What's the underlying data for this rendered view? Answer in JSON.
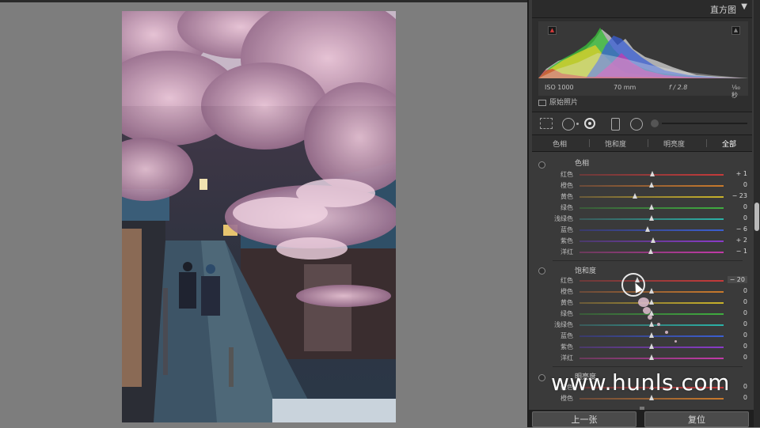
{
  "histogram": {
    "title": "直方图",
    "toggle_icon": "triangle-down",
    "exif": {
      "iso": "ISO 1000",
      "focal": "70 mm",
      "aperture": "f / 2.8",
      "shutter": "¹⁄₈₀ 秒"
    },
    "original_label": "原始照片"
  },
  "hsl": {
    "tabs": [
      "色相",
      "饱和度",
      "明亮度",
      "全部"
    ],
    "active_tab": "全部",
    "hue": {
      "title": "色相",
      "rows": [
        {
          "label": "红色",
          "value": "+ 1",
          "level": 1
        },
        {
          "label": "橙色",
          "value": "0",
          "level": 0
        },
        {
          "label": "黄色",
          "value": "− 23",
          "level": -23
        },
        {
          "label": "绿色",
          "value": "0",
          "level": 0
        },
        {
          "label": "浅绿色",
          "value": "0",
          "level": 0
        },
        {
          "label": "蓝色",
          "value": "− 6",
          "level": -6
        },
        {
          "label": "紫色",
          "value": "+ 2",
          "level": 2
        },
        {
          "label": "洋红",
          "value": "− 1",
          "level": -1
        }
      ]
    },
    "saturation": {
      "title": "饱和度",
      "rows": [
        {
          "label": "红色",
          "value": "− 20",
          "level": -20
        },
        {
          "label": "橙色",
          "value": "0",
          "level": 0
        },
        {
          "label": "黄色",
          "value": "0",
          "level": 0
        },
        {
          "label": "绿色",
          "value": "0",
          "level": 0
        },
        {
          "label": "浅绿色",
          "value": "0",
          "level": 0
        },
        {
          "label": "蓝色",
          "value": "0",
          "level": 0
        },
        {
          "label": "紫色",
          "value": "0",
          "level": 0
        },
        {
          "label": "洋红",
          "value": "0",
          "level": 0
        }
      ]
    },
    "luminance": {
      "title": "明亮度",
      "rows": [
        {
          "label": "红色",
          "value": "0",
          "level": 0
        },
        {
          "label": "橙色",
          "value": "0",
          "level": 0
        }
      ]
    }
  },
  "footer": {
    "prev_label": "上一张",
    "reset_label": "复位"
  },
  "watermark": "www.hunls.com",
  "colors": {
    "panel_bg": "#3a3a3a",
    "canvas_bg": "#7d7d7d",
    "red": "#c63a3a",
    "orange": "#c97a2c",
    "yellow": "#c9b32a",
    "green": "#3fae3f",
    "aqua": "#2bb3a8",
    "blue": "#3b5fd1",
    "purple": "#8a3bc9",
    "magenta": "#c23aa8"
  }
}
